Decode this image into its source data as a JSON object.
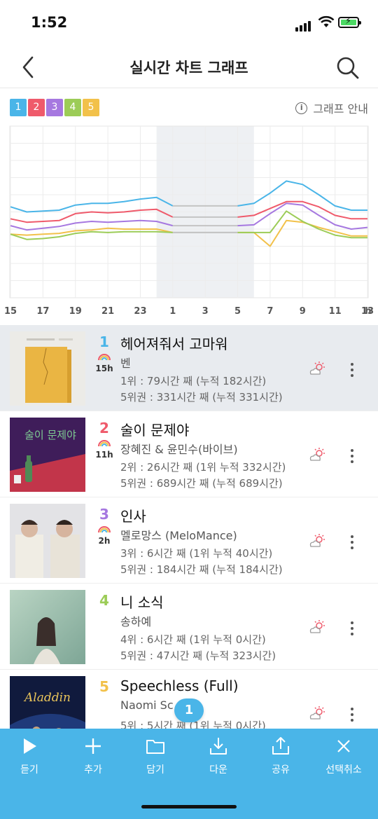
{
  "status": {
    "time": "1:52"
  },
  "header": {
    "title": "실시간 차트 그래프"
  },
  "legend": [
    {
      "label": "1",
      "color": "#4ab5e8"
    },
    {
      "label": "2",
      "color": "#ef5a6b"
    },
    {
      "label": "3",
      "color": "#a678e0"
    },
    {
      "label": "4",
      "color": "#9ccc57"
    },
    {
      "label": "5",
      "color": "#f2c14a"
    }
  ],
  "guide_label": "그래프 안내",
  "chart_data": {
    "type": "line",
    "x": [
      "15",
      "16",
      "17",
      "18",
      "19",
      "20",
      "21",
      "22",
      "23",
      "0",
      "1",
      "2",
      "3",
      "4",
      "5",
      "6",
      "7",
      "8",
      "9",
      "10",
      "11",
      "12",
      "13"
    ],
    "tick_labels": [
      "15",
      "17",
      "19",
      "21",
      "23",
      "1",
      "3",
      "5",
      "7",
      "9",
      "11",
      "13"
    ],
    "x_unit": "h",
    "grid": true,
    "series": [
      {
        "color": "#4ab5e8",
        "values": [
          53,
          50,
          50.5,
          51,
          54,
          55,
          55,
          56,
          57.5,
          58.5,
          53.5,
          53.5,
          53.5,
          53.5,
          53.5,
          55,
          61,
          68,
          66,
          60,
          53.5,
          51,
          51
        ]
      },
      {
        "color": "#ef5a6b",
        "values": [
          46,
          44,
          44.5,
          45,
          49,
          50,
          49.5,
          50,
          51,
          51.5,
          47,
          47,
          47,
          47,
          47,
          48,
          52,
          56,
          56,
          53,
          48,
          46,
          46
        ]
      },
      {
        "color": "#a678e0",
        "values": [
          42,
          39.5,
          40.5,
          41.5,
          43.5,
          44.5,
          44,
          44.5,
          45,
          44.5,
          42,
          42,
          42,
          42,
          42,
          42.5,
          49,
          55,
          54,
          48,
          42.5,
          40,
          41
        ]
      },
      {
        "color": "#9ccc57",
        "values": [
          37,
          34,
          34.5,
          35.5,
          37.5,
          38.5,
          38,
          38.5,
          38.5,
          38.5,
          38,
          38,
          38,
          38,
          38,
          38,
          38,
          50.5,
          44.5,
          40,
          36.5,
          35,
          35
        ]
      },
      {
        "color": "#f2c14a",
        "values": [
          37,
          36.5,
          37,
          37.5,
          39,
          39.5,
          40.5,
          40,
          40,
          40,
          38,
          38,
          38,
          38,
          38,
          38,
          30,
          45,
          44,
          41,
          38.5,
          36,
          36
        ]
      }
    ],
    "gap_color": "#c4c4c4",
    "gap_range": [
      "1",
      "5"
    ],
    "shaded_range": [
      "0",
      "6"
    ]
  },
  "songs": [
    {
      "rank": "1",
      "rank_color": "#4ab5e8",
      "hours": "15h",
      "title": "헤어져줘서 고마워",
      "artist": "벤",
      "stat1": "1위 : 79시간 째 (누적 182시간)",
      "stat2": "5위권 : 331시간 째 (누적 331시간)"
    },
    {
      "rank": "2",
      "rank_color": "#ef5a6b",
      "hours": "11h",
      "title": "술이 문제야",
      "artist": "장혜진 & 윤민수(바이브)",
      "stat1": "2위 : 26시간 째 (1위 누적 332시간)",
      "stat2": "5위권 : 689시간 째 (누적 689시간)",
      "cover_text": "술이 문제야"
    },
    {
      "rank": "3",
      "rank_color": "#a678e0",
      "hours": "2h",
      "title": "인사",
      "artist": "멜로망스 (MeloMance)",
      "stat1": "3위 : 6시간 째 (1위 누적 40시간)",
      "stat2": "5위권 : 184시간 째 (누적 184시간)"
    },
    {
      "rank": "4",
      "rank_color": "#9ccc57",
      "hours": "",
      "title": "니 소식",
      "artist": "송하예",
      "stat1": "4위 : 6시간 째 (1위 누적 0시간)",
      "stat2": "5위권 : 47시간 째 (누적 323시간)"
    },
    {
      "rank": "5",
      "rank_color": "#f2c14a",
      "hours": "",
      "title": "Speechless (Full)",
      "artist": "Naomi Sc",
      "stat1": "5위 : 5시간 째 (1위 누적 0시간)",
      "stat2": "",
      "cover_text": "Aladdin"
    }
  ],
  "selected_count": "1",
  "bottom_bar": [
    {
      "label": "듣기",
      "icon": "play-icon"
    },
    {
      "label": "추가",
      "icon": "plus-icon"
    },
    {
      "label": "담기",
      "icon": "folder-icon"
    },
    {
      "label": "다운",
      "icon": "download-icon"
    },
    {
      "label": "공유",
      "icon": "share-icon"
    },
    {
      "label": "선택취소",
      "icon": "close-icon"
    }
  ]
}
